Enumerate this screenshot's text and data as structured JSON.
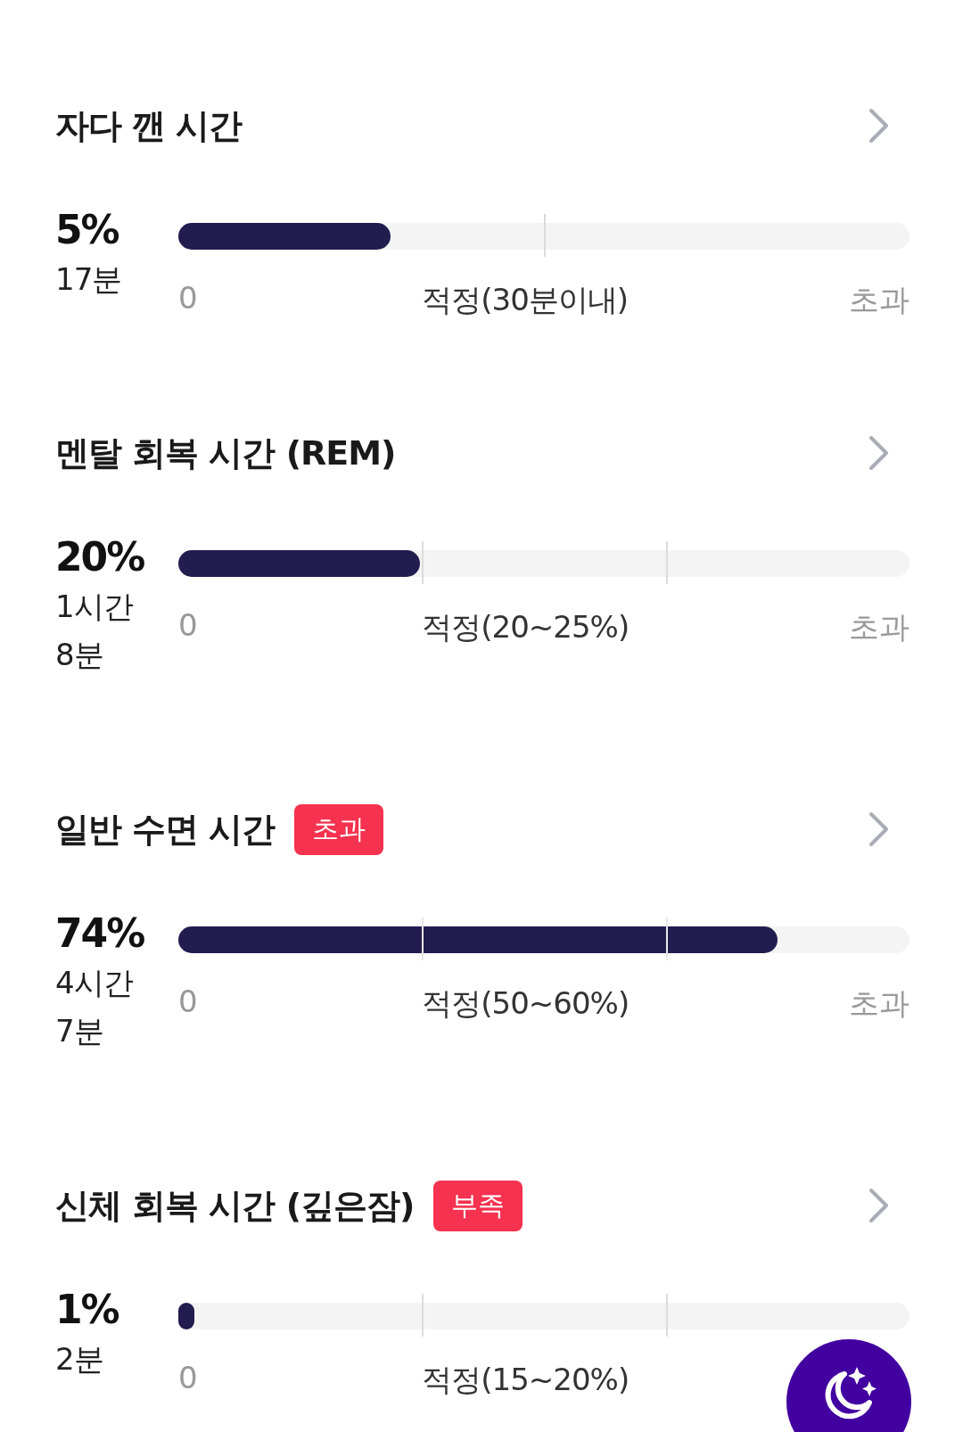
{
  "sections": [
    {
      "title": "자다 깬 시간",
      "kind": "single",
      "percent": "5%",
      "time": "17분",
      "level": 0.29,
      "axis": {
        "start": "0",
        "optimal": "적정(30분이내)",
        "over": "초과"
      }
    },
    {
      "title": "멘탈 회복 시간 (REM)",
      "kind": "double",
      "percent": "20%",
      "time": "1시간 8분",
      "level": 0.33,
      "axis": {
        "start": "0",
        "optimal": "적정(20~25%)",
        "over": "초과"
      }
    },
    {
      "title": "일반 수면 시간",
      "kind": "double",
      "badge": {
        "label": "초과",
        "color": "#f5324f"
      },
      "percent": "74%",
      "time": "4시간 7분",
      "level": 0.82,
      "axis": {
        "start": "0",
        "optimal": "적정(50~60%)",
        "over": "초과"
      }
    },
    {
      "title": "신체 회복 시간 (깊은잠)",
      "kind": "double",
      "badge": {
        "label": "부족",
        "color": "#f5324f"
      },
      "percent": "1%",
      "time": "2분",
      "level": 0.02,
      "axis": {
        "start": "0",
        "optimal": "적정(15~20%)"
      }
    }
  ]
}
